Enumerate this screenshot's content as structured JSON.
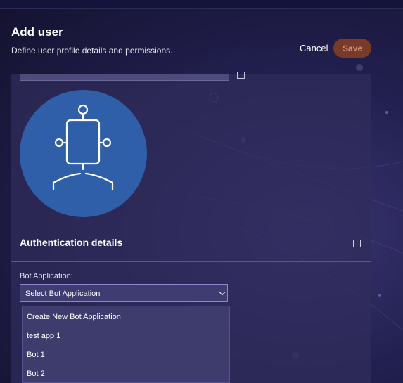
{
  "header": {
    "title": "Add user",
    "subtitle": "Define user profile details and permissions."
  },
  "actions": {
    "cancel_label": "Cancel",
    "save_label": "Save"
  },
  "avatar": {
    "icon": "bot-icon"
  },
  "auth": {
    "title": "Authentication details",
    "info_icon": "info-icon",
    "bot_app_label": "Bot Application:",
    "bot_app_value": "Select Bot Application",
    "options": [
      "Create New Bot Application",
      "test app 1",
      "Bot 1",
      "Bot 2"
    ]
  },
  "colors": {
    "accent_save": "#7a3a28",
    "avatar_bg": "#2e5fa8",
    "panel_bg": "#302d5c"
  }
}
